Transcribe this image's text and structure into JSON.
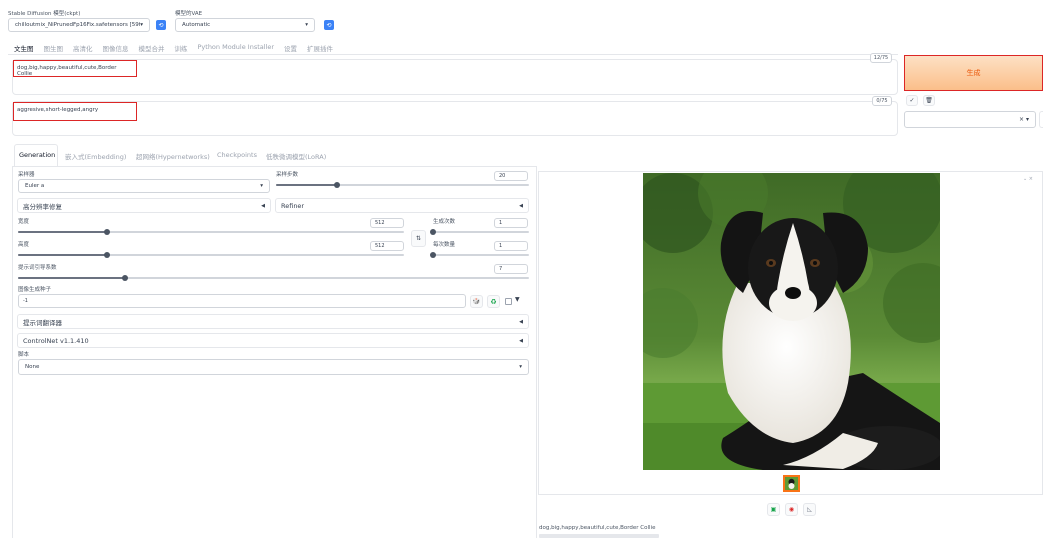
{
  "top": {
    "checkpoint_label": "Stable Diffusion 模型(ckpt)",
    "checkpoint_value": "chilloutmix_NiPrunedFp16Fix.safetensors [59ffe",
    "vae_label": "模型的VAE",
    "vae_value": "Automatic"
  },
  "main_tabs": [
    "文生图",
    "图生图",
    "高清化",
    "图像信息",
    "模型合并",
    "训练",
    "Python Module Installer",
    "设置",
    "扩展插件"
  ],
  "prompt": {
    "text": "dog,big,happy,beautiful,cute,Border Collie",
    "counter": "12/75"
  },
  "negative": {
    "text": "aggresive,short-legged,angry",
    "counter": "0/75"
  },
  "generate_label": "生成",
  "sub_tabs": [
    "Generation",
    "嵌入式(Embedding)",
    "超网络(Hypernetworks)",
    "Checkpoints",
    "低秩微调模型(LoRA)"
  ],
  "sampler": {
    "label": "采样器",
    "value": "Euler a"
  },
  "steps": {
    "label": "采样步数",
    "value": "20",
    "fraction": 0.24
  },
  "hires_label": "高分辨率修复",
  "refiner_label": "Refiner",
  "width": {
    "label": "宽度",
    "value": "512",
    "fraction": 0.23
  },
  "height": {
    "label": "高度",
    "value": "512",
    "fraction": 0.23
  },
  "batch_count": {
    "label": "生成次数",
    "value": "1",
    "fraction": 0.0
  },
  "batch_size": {
    "label": "每次数量",
    "value": "1",
    "fraction": 0.0
  },
  "cfg": {
    "label": "提示词引导系数",
    "value": "7",
    "fraction": 0.21
  },
  "seed": {
    "label": "图像生成种子",
    "value": "-1"
  },
  "prompt_translator_label": "提示词翻译器",
  "controlnet_label": "ControlNet v1.1.410",
  "script": {
    "label": "脚本",
    "value": "None"
  },
  "output_caption": "dog,big,happy,beautiful,cute,Border Collie",
  "colors": {
    "accent": "#3b82f6",
    "generate_from": "#fcd9b8",
    "generate_to": "#fbb985",
    "generate_text": "#ea580c",
    "highlight_border": "#dc2626"
  }
}
